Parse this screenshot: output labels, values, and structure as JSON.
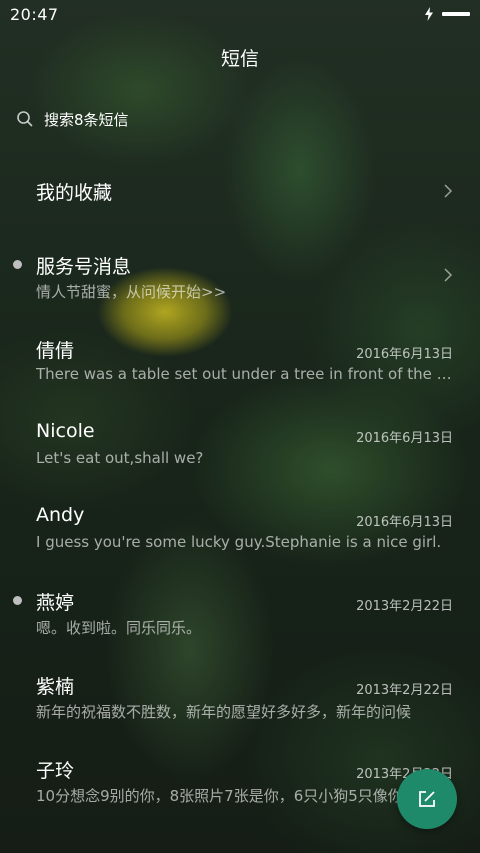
{
  "status_bar": {
    "time": "20:47"
  },
  "header": {
    "title": "短信"
  },
  "search": {
    "label": "搜索8条短信"
  },
  "favorites": {
    "label": "我的收藏"
  },
  "service": {
    "title": "服务号消息",
    "preview": "情人节甜蜜，从问候开始>>"
  },
  "conversations": [
    {
      "name": "倩倩",
      "date": "2016年6月13日",
      "preview": "There was a table set out under a tree in front of the house",
      "unread": false
    },
    {
      "name": "Nicole",
      "date": "2016年6月13日",
      "preview": "Let's eat out,shall we?",
      "unread": false
    },
    {
      "name": "Andy",
      "date": "2016年6月13日",
      "preview": "I guess you're some lucky guy.Stephanie is a nice girl.",
      "unread": false
    },
    {
      "name": "燕婷",
      "date": "2013年2月22日",
      "preview": "嗯。收到啦。同乐同乐。",
      "unread": true
    },
    {
      "name": "紫楠",
      "date": "2013年2月22日",
      "preview": "新年的祝福数不胜数，新年的愿望好多好多，新年的问候",
      "unread": false
    },
    {
      "name": "子玲",
      "date": "2013年2月22日",
      "preview": "10分想念9别的你，8张照片7张是你，6只小狗5只像你",
      "unread": false
    }
  ],
  "colors": {
    "fab": "#1f8a6a",
    "unread_dot": "#bfbfbf"
  }
}
